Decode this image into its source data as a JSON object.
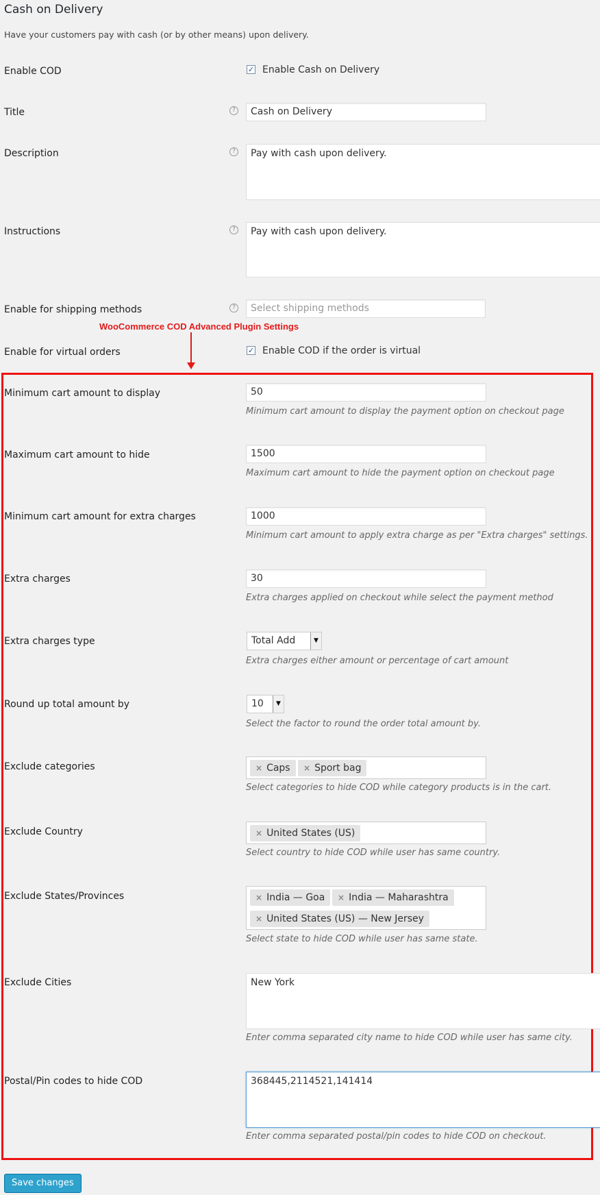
{
  "header": {
    "title": "Cash on Delivery",
    "subtitle": "Have your customers pay with cash (or by other means) upon delivery."
  },
  "fields": {
    "enable_cod": {
      "label": "Enable COD",
      "checkbox_label": "Enable Cash on Delivery",
      "checked": true
    },
    "title": {
      "label": "Title",
      "value": "Cash on Delivery"
    },
    "description": {
      "label": "Description",
      "value": "Pay with cash upon delivery."
    },
    "instructions": {
      "label": "Instructions",
      "value": "Pay with cash upon delivery."
    },
    "shipping_methods": {
      "label": "Enable for shipping methods",
      "placeholder": "Select shipping methods"
    },
    "virtual_orders": {
      "label": "Enable for virtual orders",
      "checkbox_label": "Enable COD if the order is virtual",
      "checked": true
    },
    "min_cart": {
      "label": "Minimum cart amount to display",
      "value": "50",
      "desc": "Minimum cart amount to display the payment option on checkout page"
    },
    "max_cart": {
      "label": "Maximum cart amount to hide",
      "value": "1500",
      "desc": "Maximum cart amount to hide the payment option on checkout page"
    },
    "min_extra": {
      "label": "Minimum cart amount for extra charges",
      "value": "1000",
      "desc": "Minimum cart amount to apply extra charge as per \"Extra charges\" settings."
    },
    "extra_charges": {
      "label": "Extra charges",
      "value": "30",
      "desc": "Extra charges applied on checkout while select the payment method"
    },
    "extra_type": {
      "label": "Extra charges type",
      "value": "Total Add",
      "desc": "Extra charges either amount or percentage of cart amount"
    },
    "round_up": {
      "label": "Round up total amount by",
      "value": "10",
      "desc": "Select the factor to round the order total amount by."
    },
    "exclude_categories": {
      "label": "Exclude categories",
      "tags": [
        "Caps",
        "Sport bag"
      ],
      "desc": "Select categories to hide COD while category products is in the cart."
    },
    "exclude_country": {
      "label": "Exclude Country",
      "tags": [
        "United States (US)"
      ],
      "desc": "Select country to hide COD while user has same country."
    },
    "exclude_states": {
      "label": "Exclude States/Provinces",
      "tags": [
        "India — Goa",
        "India — Maharashtra",
        "United States (US) — New Jersey"
      ],
      "desc": "Select state to hide COD while user has same state."
    },
    "exclude_cities": {
      "label": "Exclude Cities",
      "value": "New York",
      "desc": "Enter comma separated city name to hide COD while user has same city."
    },
    "postal_codes": {
      "label": "Postal/Pin codes to hide COD",
      "value": "368445,2114521,141414",
      "desc": "Enter comma separated postal/pin codes to hide COD on checkout."
    }
  },
  "annotation": {
    "text": "WooCommerce COD Advanced Plugin Settings",
    "color": "#e31a1a"
  },
  "footer": {
    "save_label": "Save changes",
    "button_color": "#2ea2cc"
  },
  "icons": {
    "help": "help-circle-icon",
    "check": "checkmark-icon",
    "dropdown": "triangle-down-icon",
    "remove": "x-icon"
  }
}
